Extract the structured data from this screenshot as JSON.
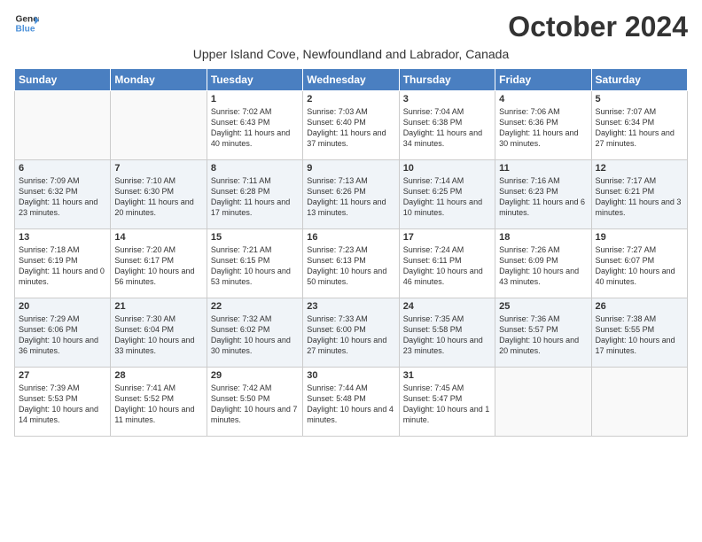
{
  "header": {
    "logo_line1": "General",
    "logo_line2": "Blue",
    "month_title": "October 2024",
    "subtitle": "Upper Island Cove, Newfoundland and Labrador, Canada"
  },
  "weekdays": [
    "Sunday",
    "Monday",
    "Tuesday",
    "Wednesday",
    "Thursday",
    "Friday",
    "Saturday"
  ],
  "weeks": [
    [
      {
        "day": "",
        "info": ""
      },
      {
        "day": "",
        "info": ""
      },
      {
        "day": "1",
        "info": "Sunrise: 7:02 AM\nSunset: 6:43 PM\nDaylight: 11 hours and 40 minutes."
      },
      {
        "day": "2",
        "info": "Sunrise: 7:03 AM\nSunset: 6:40 PM\nDaylight: 11 hours and 37 minutes."
      },
      {
        "day": "3",
        "info": "Sunrise: 7:04 AM\nSunset: 6:38 PM\nDaylight: 11 hours and 34 minutes."
      },
      {
        "day": "4",
        "info": "Sunrise: 7:06 AM\nSunset: 6:36 PM\nDaylight: 11 hours and 30 minutes."
      },
      {
        "day": "5",
        "info": "Sunrise: 7:07 AM\nSunset: 6:34 PM\nDaylight: 11 hours and 27 minutes."
      }
    ],
    [
      {
        "day": "6",
        "info": "Sunrise: 7:09 AM\nSunset: 6:32 PM\nDaylight: 11 hours and 23 minutes."
      },
      {
        "day": "7",
        "info": "Sunrise: 7:10 AM\nSunset: 6:30 PM\nDaylight: 11 hours and 20 minutes."
      },
      {
        "day": "8",
        "info": "Sunrise: 7:11 AM\nSunset: 6:28 PM\nDaylight: 11 hours and 17 minutes."
      },
      {
        "day": "9",
        "info": "Sunrise: 7:13 AM\nSunset: 6:26 PM\nDaylight: 11 hours and 13 minutes."
      },
      {
        "day": "10",
        "info": "Sunrise: 7:14 AM\nSunset: 6:25 PM\nDaylight: 11 hours and 10 minutes."
      },
      {
        "day": "11",
        "info": "Sunrise: 7:16 AM\nSunset: 6:23 PM\nDaylight: 11 hours and 6 minutes."
      },
      {
        "day": "12",
        "info": "Sunrise: 7:17 AM\nSunset: 6:21 PM\nDaylight: 11 hours and 3 minutes."
      }
    ],
    [
      {
        "day": "13",
        "info": "Sunrise: 7:18 AM\nSunset: 6:19 PM\nDaylight: 11 hours and 0 minutes."
      },
      {
        "day": "14",
        "info": "Sunrise: 7:20 AM\nSunset: 6:17 PM\nDaylight: 10 hours and 56 minutes."
      },
      {
        "day": "15",
        "info": "Sunrise: 7:21 AM\nSunset: 6:15 PM\nDaylight: 10 hours and 53 minutes."
      },
      {
        "day": "16",
        "info": "Sunrise: 7:23 AM\nSunset: 6:13 PM\nDaylight: 10 hours and 50 minutes."
      },
      {
        "day": "17",
        "info": "Sunrise: 7:24 AM\nSunset: 6:11 PM\nDaylight: 10 hours and 46 minutes."
      },
      {
        "day": "18",
        "info": "Sunrise: 7:26 AM\nSunset: 6:09 PM\nDaylight: 10 hours and 43 minutes."
      },
      {
        "day": "19",
        "info": "Sunrise: 7:27 AM\nSunset: 6:07 PM\nDaylight: 10 hours and 40 minutes."
      }
    ],
    [
      {
        "day": "20",
        "info": "Sunrise: 7:29 AM\nSunset: 6:06 PM\nDaylight: 10 hours and 36 minutes."
      },
      {
        "day": "21",
        "info": "Sunrise: 7:30 AM\nSunset: 6:04 PM\nDaylight: 10 hours and 33 minutes."
      },
      {
        "day": "22",
        "info": "Sunrise: 7:32 AM\nSunset: 6:02 PM\nDaylight: 10 hours and 30 minutes."
      },
      {
        "day": "23",
        "info": "Sunrise: 7:33 AM\nSunset: 6:00 PM\nDaylight: 10 hours and 27 minutes."
      },
      {
        "day": "24",
        "info": "Sunrise: 7:35 AM\nSunset: 5:58 PM\nDaylight: 10 hours and 23 minutes."
      },
      {
        "day": "25",
        "info": "Sunrise: 7:36 AM\nSunset: 5:57 PM\nDaylight: 10 hours and 20 minutes."
      },
      {
        "day": "26",
        "info": "Sunrise: 7:38 AM\nSunset: 5:55 PM\nDaylight: 10 hours and 17 minutes."
      }
    ],
    [
      {
        "day": "27",
        "info": "Sunrise: 7:39 AM\nSunset: 5:53 PM\nDaylight: 10 hours and 14 minutes."
      },
      {
        "day": "28",
        "info": "Sunrise: 7:41 AM\nSunset: 5:52 PM\nDaylight: 10 hours and 11 minutes."
      },
      {
        "day": "29",
        "info": "Sunrise: 7:42 AM\nSunset: 5:50 PM\nDaylight: 10 hours and 7 minutes."
      },
      {
        "day": "30",
        "info": "Sunrise: 7:44 AM\nSunset: 5:48 PM\nDaylight: 10 hours and 4 minutes."
      },
      {
        "day": "31",
        "info": "Sunrise: 7:45 AM\nSunset: 5:47 PM\nDaylight: 10 hours and 1 minute."
      },
      {
        "day": "",
        "info": ""
      },
      {
        "day": "",
        "info": ""
      }
    ]
  ]
}
